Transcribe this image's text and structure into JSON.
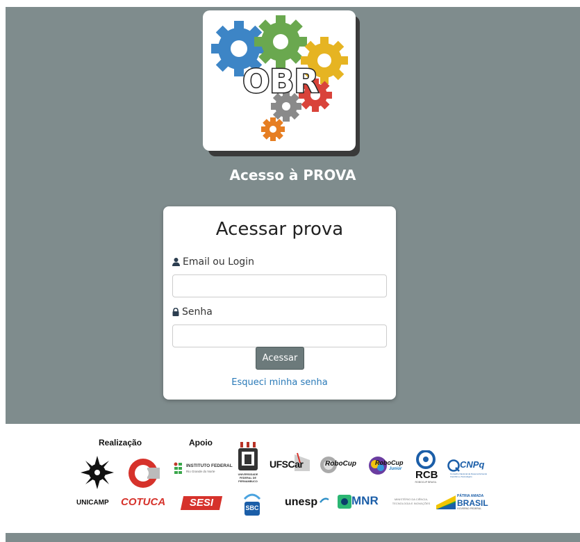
{
  "logo": {
    "text": "OBR",
    "colors": {
      "blue": "#3d85c6",
      "green": "#6aa84f",
      "yellow": "#e6b422",
      "gray": "#8a8a8a",
      "red": "#d9433a",
      "orange": "#e67e22"
    }
  },
  "hero": {
    "title": "Acesso à PROVA",
    "background": "#7f8c8d"
  },
  "login": {
    "title": "Acessar prova",
    "email_label": "Email ou Login",
    "email_value": "",
    "password_label": "Senha",
    "password_value": "",
    "submit_label": "Acessar",
    "forgot_link": "Esqueci minha senha",
    "link_color": "#2a7ab8"
  },
  "sponsors": {
    "realizacao_label": "Realização",
    "apoio_label": "Apoio",
    "logos": {
      "unicamp": "UNICAMP",
      "cotuca": "COTUCA",
      "ifrn": "INSTITUTO FEDERAL",
      "ifrn_sub": "Rio Grande do Norte",
      "sesi": "SESI",
      "ufpe": "UNIVERSIDADE FEDERAL DE PERNAMBUCO",
      "sbc": "SBC",
      "ufscar": "UFSCar",
      "unesp": "unesp",
      "robocup": "RoboCup",
      "robocup_junior": "RoboCup",
      "robocup_junior_sub": "Junior",
      "mnr": "MNR",
      "rcb": "RCB",
      "rcb_sub": "ROBOCUP BRASIL",
      "mctic": "MINISTÉRIO DA CIÊNCIA, TECNOLOGIA E INOVAÇÕES",
      "cnpq": "CNPq",
      "cnpq_sub": "Conselho Nacional de Desenvolvimento Científico e Tecnológico",
      "brasil_top": "PÁTRIA AMADA",
      "brasil": "BRASIL",
      "brasil_sub": "GOVERNO FEDERAL"
    }
  }
}
